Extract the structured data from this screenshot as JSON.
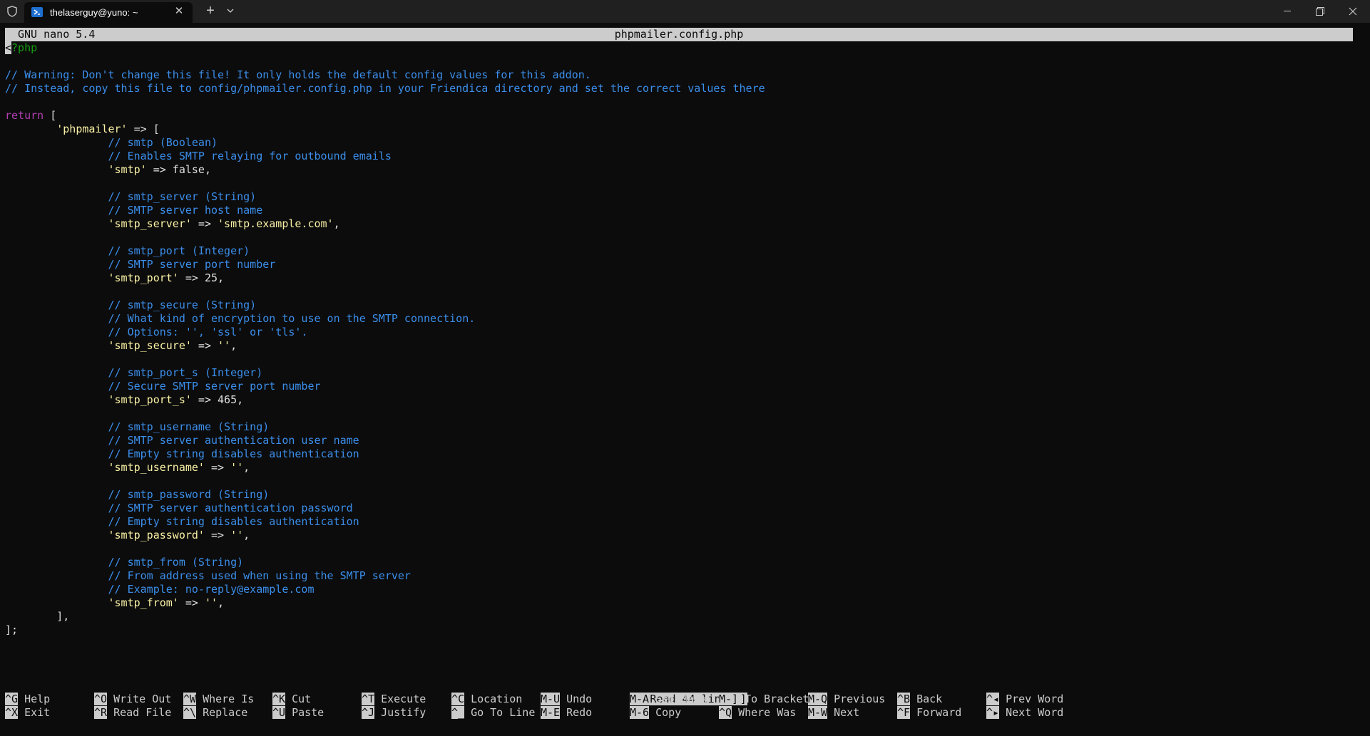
{
  "window": {
    "tab_title": "thelaserguy@yuno: ~",
    "tab_close": "✕",
    "new_tab": "+",
    "icons": [
      "shield-icon",
      "powershell-icon",
      "close-icon",
      "chevron-down-icon",
      "minimize-icon",
      "maximize-icon",
      "close-window-icon"
    ]
  },
  "nano": {
    "version": "GNU nano 5.4",
    "filename": "phpmailer.config.php",
    "status": "[ Read 44 lines ]",
    "lines": [
      [
        {
          "t": "<",
          "c": "cursor"
        },
        {
          "t": "?php",
          "c": "tag"
        }
      ],
      [],
      [
        {
          "t": "// Warning: Don't change this file! It only holds the default config values for this addon.",
          "c": "com"
        }
      ],
      [
        {
          "t": "// Instead, copy this file to config/phpmailer.config.php in your Friendica directory and set the correct values there",
          "c": "com"
        }
      ],
      [],
      [
        {
          "t": "return",
          "c": "kw"
        },
        {
          "t": " [",
          "c": "txt"
        }
      ],
      [
        {
          "t": "        ",
          "c": "txt"
        },
        {
          "t": "'phpmailer'",
          "c": "str"
        },
        {
          "t": " => [",
          "c": "txt"
        }
      ],
      [
        {
          "t": "                ",
          "c": "txt"
        },
        {
          "t": "// smtp (Boolean)",
          "c": "com"
        }
      ],
      [
        {
          "t": "                ",
          "c": "txt"
        },
        {
          "t": "// Enables SMTP relaying for outbound emails",
          "c": "com"
        }
      ],
      [
        {
          "t": "                ",
          "c": "txt"
        },
        {
          "t": "'smtp'",
          "c": "str"
        },
        {
          "t": " => false,",
          "c": "txt"
        }
      ],
      [],
      [
        {
          "t": "                ",
          "c": "txt"
        },
        {
          "t": "// smtp_server (String)",
          "c": "com"
        }
      ],
      [
        {
          "t": "                ",
          "c": "txt"
        },
        {
          "t": "// SMTP server host name",
          "c": "com"
        }
      ],
      [
        {
          "t": "                ",
          "c": "txt"
        },
        {
          "t": "'smtp_server'",
          "c": "str"
        },
        {
          "t": " => ",
          "c": "txt"
        },
        {
          "t": "'smtp.example.com'",
          "c": "str"
        },
        {
          "t": ",",
          "c": "txt"
        }
      ],
      [],
      [
        {
          "t": "                ",
          "c": "txt"
        },
        {
          "t": "// smtp_port (Integer)",
          "c": "com"
        }
      ],
      [
        {
          "t": "                ",
          "c": "txt"
        },
        {
          "t": "// SMTP server port number",
          "c": "com"
        }
      ],
      [
        {
          "t": "                ",
          "c": "txt"
        },
        {
          "t": "'smtp_port'",
          "c": "str"
        },
        {
          "t": " => 25,",
          "c": "txt"
        }
      ],
      [],
      [
        {
          "t": "                ",
          "c": "txt"
        },
        {
          "t": "// smtp_secure (String)",
          "c": "com"
        }
      ],
      [
        {
          "t": "                ",
          "c": "txt"
        },
        {
          "t": "// What kind of encryption to use on the SMTP connection.",
          "c": "com"
        }
      ],
      [
        {
          "t": "                ",
          "c": "txt"
        },
        {
          "t": "// Options: '', 'ssl' or 'tls'.",
          "c": "com"
        }
      ],
      [
        {
          "t": "                ",
          "c": "txt"
        },
        {
          "t": "'smtp_secure'",
          "c": "str"
        },
        {
          "t": " => ",
          "c": "txt"
        },
        {
          "t": "''",
          "c": "str"
        },
        {
          "t": ",",
          "c": "txt"
        }
      ],
      [],
      [
        {
          "t": "                ",
          "c": "txt"
        },
        {
          "t": "// smtp_port_s (Integer)",
          "c": "com"
        }
      ],
      [
        {
          "t": "                ",
          "c": "txt"
        },
        {
          "t": "// Secure SMTP server port number",
          "c": "com"
        }
      ],
      [
        {
          "t": "                ",
          "c": "txt"
        },
        {
          "t": "'smtp_port_s'",
          "c": "str"
        },
        {
          "t": " => 465,",
          "c": "txt"
        }
      ],
      [],
      [
        {
          "t": "                ",
          "c": "txt"
        },
        {
          "t": "// smtp_username (String)",
          "c": "com"
        }
      ],
      [
        {
          "t": "                ",
          "c": "txt"
        },
        {
          "t": "// SMTP server authentication user name",
          "c": "com"
        }
      ],
      [
        {
          "t": "                ",
          "c": "txt"
        },
        {
          "t": "// Empty string disables authentication",
          "c": "com"
        }
      ],
      [
        {
          "t": "                ",
          "c": "txt"
        },
        {
          "t": "'smtp_username'",
          "c": "str"
        },
        {
          "t": " => ",
          "c": "txt"
        },
        {
          "t": "''",
          "c": "str"
        },
        {
          "t": ",",
          "c": "txt"
        }
      ],
      [],
      [
        {
          "t": "                ",
          "c": "txt"
        },
        {
          "t": "// smtp_password (String)",
          "c": "com"
        }
      ],
      [
        {
          "t": "                ",
          "c": "txt"
        },
        {
          "t": "// SMTP server authentication password",
          "c": "com"
        }
      ],
      [
        {
          "t": "                ",
          "c": "txt"
        },
        {
          "t": "// Empty string disables authentication",
          "c": "com"
        }
      ],
      [
        {
          "t": "                ",
          "c": "txt"
        },
        {
          "t": "'smtp_password'",
          "c": "str"
        },
        {
          "t": " => ",
          "c": "txt"
        },
        {
          "t": "''",
          "c": "str"
        },
        {
          "t": ",",
          "c": "txt"
        }
      ],
      [],
      [
        {
          "t": "                ",
          "c": "txt"
        },
        {
          "t": "// smtp_from (String)",
          "c": "com"
        }
      ],
      [
        {
          "t": "                ",
          "c": "txt"
        },
        {
          "t": "// From address used when using the SMTP server",
          "c": "com"
        }
      ],
      [
        {
          "t": "                ",
          "c": "txt"
        },
        {
          "t": "// Example: no-reply@example.com",
          "c": "com"
        }
      ],
      [
        {
          "t": "                ",
          "c": "txt"
        },
        {
          "t": "'smtp_from'",
          "c": "str"
        },
        {
          "t": " => ",
          "c": "txt"
        },
        {
          "t": "''",
          "c": "str"
        },
        {
          "t": ",",
          "c": "txt"
        }
      ],
      [
        {
          "t": "        ],",
          "c": "txt"
        }
      ],
      [
        {
          "t": "];",
          "c": "txt"
        }
      ]
    ],
    "shortcuts": [
      [
        {
          "key": "^G",
          "label": "Help"
        },
        {
          "key": "^X",
          "label": "Exit"
        }
      ],
      [
        {
          "key": "^O",
          "label": "Write Out"
        },
        {
          "key": "^R",
          "label": "Read File"
        }
      ],
      [
        {
          "key": "^W",
          "label": "Where Is"
        },
        {
          "key": "^\\",
          "label": "Replace"
        }
      ],
      [
        {
          "key": "^K",
          "label": "Cut"
        },
        {
          "key": "^U",
          "label": "Paste"
        }
      ],
      [
        {
          "key": "^T",
          "label": "Execute"
        },
        {
          "key": "^J",
          "label": "Justify"
        }
      ],
      [
        {
          "key": "^C",
          "label": "Location"
        },
        {
          "key": "^_",
          "label": "Go To Line"
        }
      ],
      [
        {
          "key": "M-U",
          "label": "Undo"
        },
        {
          "key": "M-E",
          "label": "Redo"
        }
      ],
      [
        {
          "key": "M-A",
          "label": "Set Mark"
        },
        {
          "key": "M-6",
          "label": "Copy"
        }
      ],
      [
        {
          "key": "M-]",
          "label": "To Bracket"
        },
        {
          "key": "^Q",
          "label": "Where Was"
        }
      ],
      [
        {
          "key": "M-Q",
          "label": "Previous"
        },
        {
          "key": "M-W",
          "label": "Next"
        }
      ],
      [
        {
          "key": "^B",
          "label": "Back"
        },
        {
          "key": "^F",
          "label": "Forward"
        }
      ],
      [
        {
          "key": "^◂",
          "label": "Prev Word"
        },
        {
          "key": "^▸",
          "label": "Next Word"
        }
      ]
    ]
  }
}
